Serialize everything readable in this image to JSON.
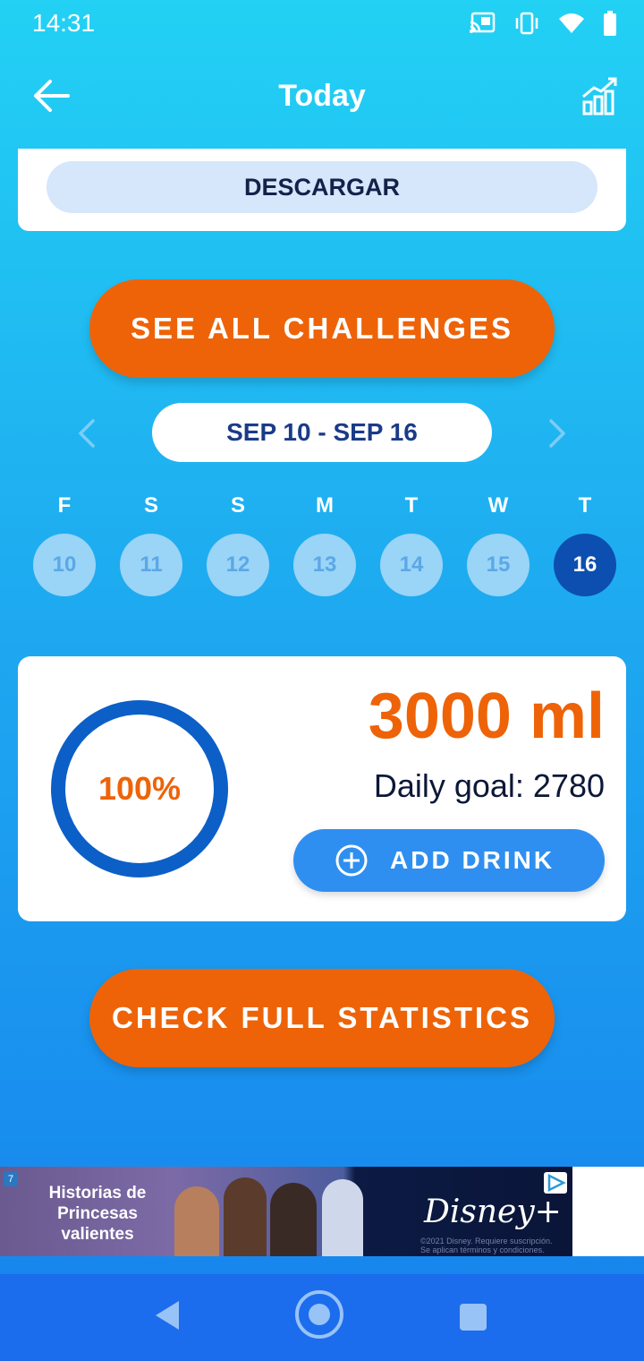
{
  "status_bar": {
    "time": "14:31",
    "icons": [
      "cast-icon",
      "vibrate-icon",
      "wifi-icon",
      "battery-icon"
    ]
  },
  "app_bar": {
    "title": "Today",
    "back_icon": "arrow-left-icon",
    "stats_icon": "chart-growth-icon"
  },
  "ad_card": {
    "button_label": "DESCARGAR"
  },
  "challenges_button": {
    "label": "SEE ALL CHALLENGES"
  },
  "week": {
    "range_label": "SEP 10 - SEP 16",
    "days": [
      {
        "letter": "F",
        "number": "10",
        "selected": false
      },
      {
        "letter": "S",
        "number": "11",
        "selected": false
      },
      {
        "letter": "S",
        "number": "12",
        "selected": false
      },
      {
        "letter": "M",
        "number": "13",
        "selected": false
      },
      {
        "letter": "T",
        "number": "14",
        "selected": false
      },
      {
        "letter": "W",
        "number": "15",
        "selected": false
      },
      {
        "letter": "T",
        "number": "16",
        "selected": true
      }
    ]
  },
  "progress": {
    "percent_label": "100%",
    "percent_value": 1.0,
    "amount": "3000 ml",
    "goal": "Daily goal: 2780",
    "add_button_label": "ADD DRINK"
  },
  "statistics_button": {
    "label": "CHECK FULL STATISTICS"
  },
  "ad_banner": {
    "headline": "Historias de Princesas valientes",
    "brand": "Disney+",
    "fine_print": "©2021 Disney. Requiere suscripción. Se aplican términos y condiciones."
  },
  "nav_bar": {
    "icons": [
      "nav-back-icon",
      "nav-home-icon",
      "nav-recents-icon"
    ]
  },
  "colors": {
    "accent_orange": "#ee6308",
    "selected_day": "#0c4fb0",
    "ring_blue": "#0c5fc7",
    "add_button": "#2f8ff0"
  }
}
